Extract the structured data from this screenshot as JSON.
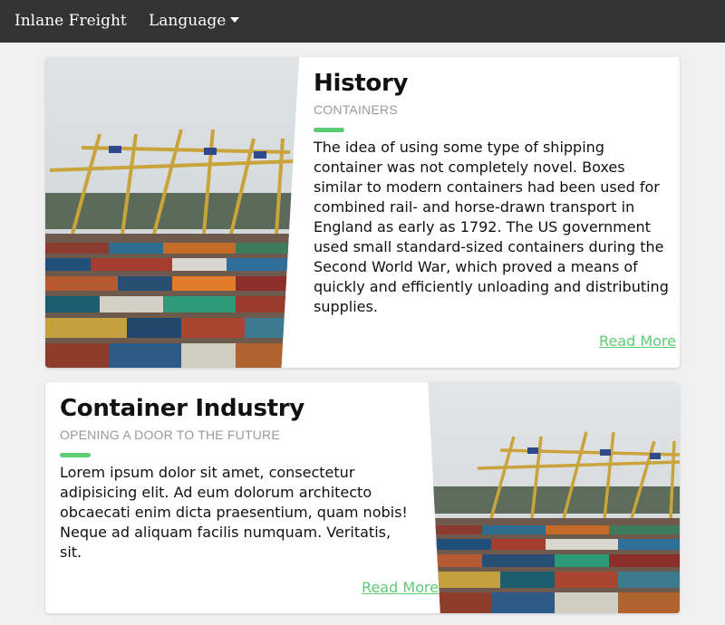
{
  "navbar": {
    "brand": "Inlane Freight",
    "language_label": "Language",
    "caret_icon": "caret-down-icon"
  },
  "cards": [
    {
      "title": "History",
      "subtitle": "CONTAINERS",
      "body": "The idea of using some type of shipping container was not completely novel. Boxes similar to modern containers had been used for combined rail- and horse-drawn transport in England as early as 1792. The US government used small standard-sized containers during the Second World War, which proved a means of quickly and efficiently unloading and distributing supplies.",
      "link": "Read More",
      "image": "container-port-photo"
    },
    {
      "title": "Container Industry",
      "subtitle": "OPENING A DOOR TO THE FUTURE",
      "body": "Lorem ipsum dolor sit amet, consectetur adipisicing elit. Ad eum dolorum architecto obcaecati enim dicta praesentium, quam nobis! Neque ad aliquam facilis numquam. Veritatis, sit.",
      "link": "Read More",
      "image": "container-port-photo"
    }
  ],
  "colors": {
    "navbar": "#333333",
    "accent": "#5ccc74",
    "background": "#f0f0f0"
  }
}
